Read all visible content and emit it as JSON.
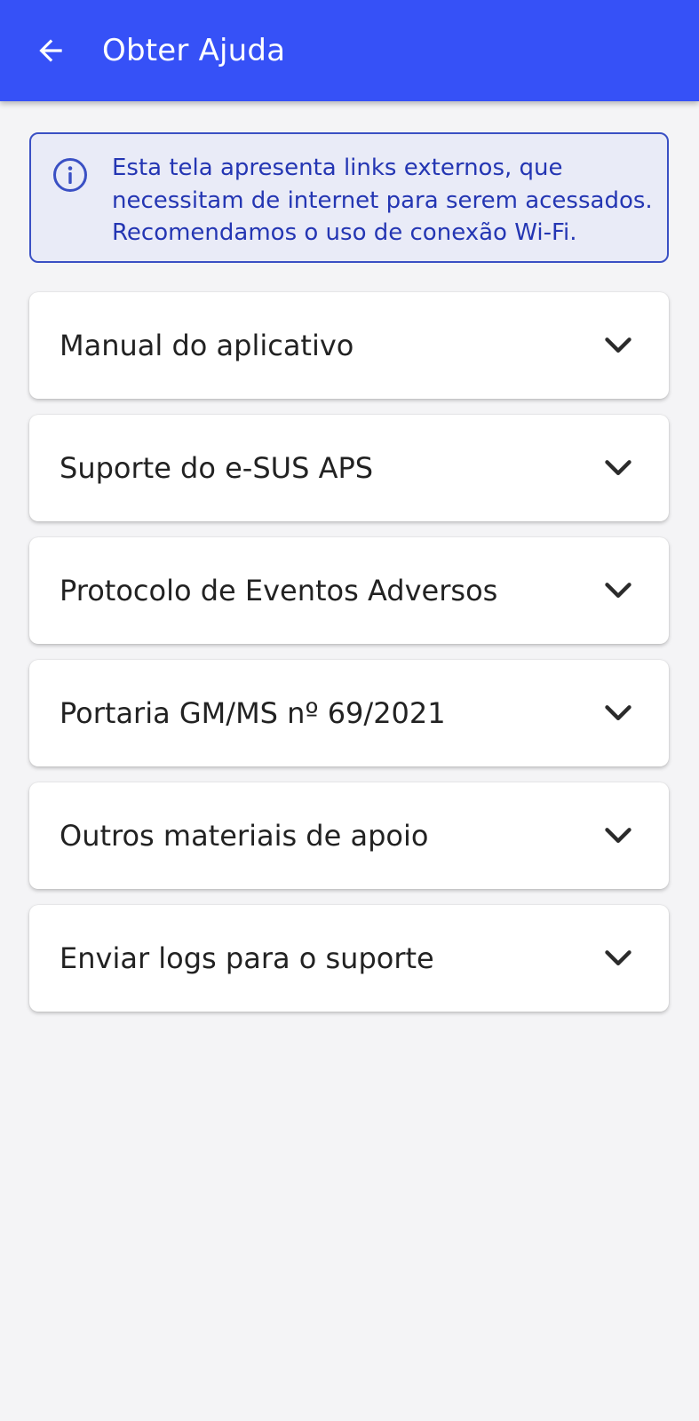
{
  "colors": {
    "app_bar": "#3651f7",
    "background": "#f4f4f6",
    "info_background": "#e9ebf7",
    "info_accent": "#3a50c4",
    "info_text": "#2436b3",
    "card_text": "#222222"
  },
  "header": {
    "back_icon": "arrow-left-icon",
    "title": "Obter Ajuda"
  },
  "info_banner": {
    "icon": "info-icon",
    "text": "Esta tela apresenta links externos, que\nnecessitam de internet para serem acessados.\nRecomendamos o uso de conexão Wi-Fi."
  },
  "sections": [
    {
      "label": "Manual do aplicativo",
      "icon": "chevron-down-icon"
    },
    {
      "label": "Suporte do e-SUS APS",
      "icon": "chevron-down-icon"
    },
    {
      "label": "Protocolo de Eventos Adversos",
      "icon": "chevron-down-icon"
    },
    {
      "label": "Portaria GM/MS nº 69/2021",
      "icon": "chevron-down-icon"
    },
    {
      "label": "Outros materiais de apoio",
      "icon": "chevron-down-icon"
    },
    {
      "label": "Enviar logs para o suporte",
      "icon": "chevron-down-icon"
    }
  ]
}
